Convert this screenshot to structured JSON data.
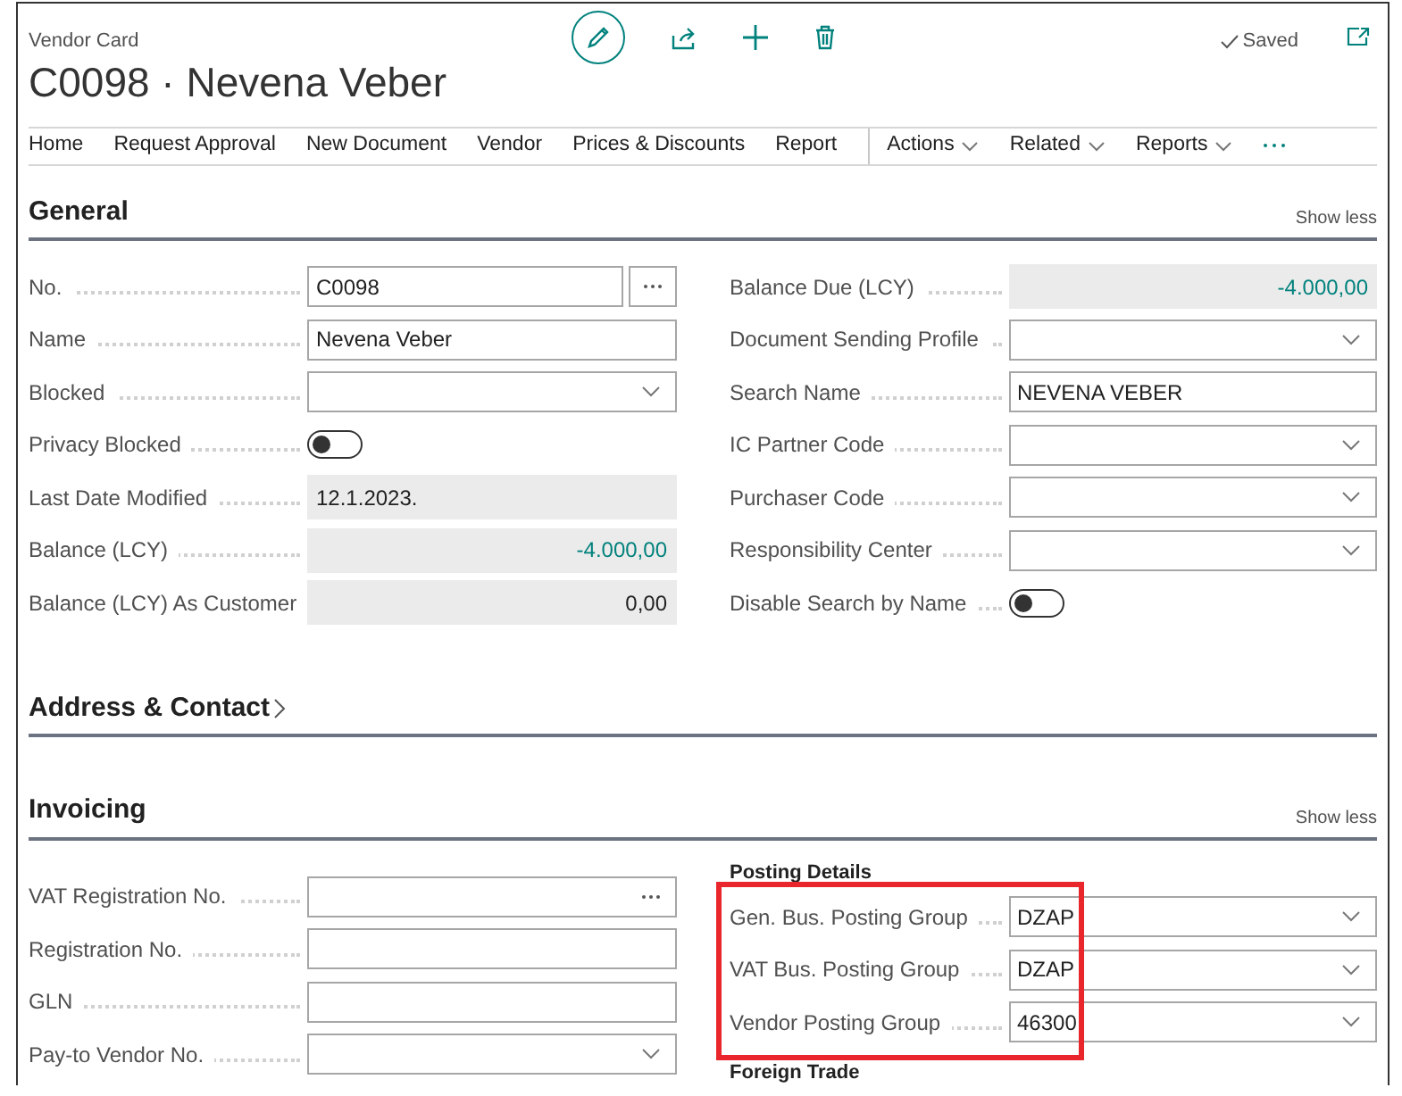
{
  "page": {
    "caption": "Vendor Card",
    "title": "C0098 · Nevena Veber",
    "saved": "Saved"
  },
  "actions": [
    {
      "label": "Home",
      "menu": false
    },
    {
      "label": "Request Approval",
      "menu": false
    },
    {
      "label": "New Document",
      "menu": false
    },
    {
      "label": "Vendor",
      "menu": false
    },
    {
      "label": "Prices & Discounts",
      "menu": false
    },
    {
      "label": "Report",
      "menu": false
    },
    {
      "label": "Actions",
      "menu": true
    },
    {
      "label": "Related",
      "menu": true
    },
    {
      "label": "Reports",
      "menu": true
    }
  ],
  "general": {
    "title": "General",
    "toggle": "Show less",
    "left": [
      {
        "kind": "lookup",
        "label": "No.",
        "value": "C0098"
      },
      {
        "kind": "text",
        "label": "Name",
        "value": "Nevena Veber"
      },
      {
        "kind": "dropdown",
        "label": "Blocked"
      },
      {
        "kind": "toggle",
        "label": "Privacy Blocked",
        "on": false
      },
      {
        "kind": "readonly",
        "label": "Last Date Modified",
        "value": "12.1.2023."
      },
      {
        "kind": "amount_link",
        "label": "Balance (LCY)",
        "value": "-4.000,00"
      },
      {
        "kind": "amount",
        "label": "Balance (LCY) As Customer",
        "value": "0,00"
      }
    ],
    "right": [
      {
        "kind": "amount_link",
        "label": "Balance Due (LCY)",
        "value": "-4.000,00"
      },
      {
        "kind": "dropdown",
        "label": "Document Sending Profile"
      },
      {
        "kind": "text",
        "label": "Search Name",
        "value": "NEVENA VEBER"
      },
      {
        "kind": "dropdown",
        "label": "IC Partner Code"
      },
      {
        "kind": "dropdown",
        "label": "Purchaser Code"
      },
      {
        "kind": "dropdown",
        "label": "Responsibility Center"
      },
      {
        "kind": "toggle",
        "label": "Disable Search by Name",
        "on": false
      }
    ]
  },
  "address": {
    "title": "Address & Contact"
  },
  "invoicing": {
    "title": "Invoicing",
    "toggle": "Show less",
    "left": [
      {
        "kind": "assist",
        "label": "VAT Registration No."
      },
      {
        "kind": "text",
        "label": "Registration No."
      },
      {
        "kind": "text",
        "label": "GLN"
      },
      {
        "kind": "dropdown",
        "label": "Pay-to Vendor No."
      }
    ],
    "posting_details": {
      "title": "Posting Details",
      "highlighted": true,
      "fields": [
        {
          "kind": "dropdown",
          "label": "Gen. Bus. Posting Group",
          "value": "DZAP"
        },
        {
          "kind": "dropdown",
          "label": "VAT Bus. Posting Group",
          "value": "DZAP"
        },
        {
          "kind": "dropdown",
          "label": "Vendor Posting Group",
          "value": "46300"
        }
      ]
    },
    "next_group": "Foreign Trade"
  }
}
